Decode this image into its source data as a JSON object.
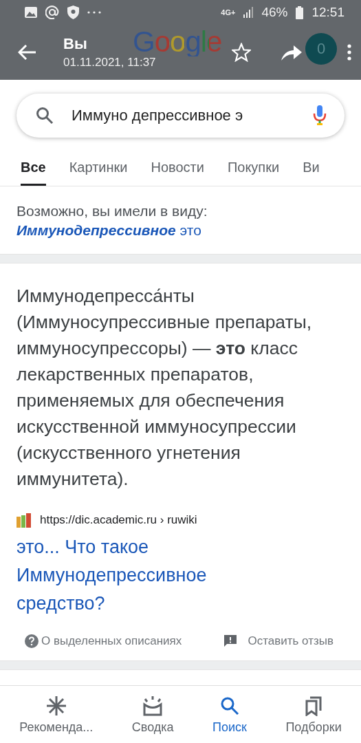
{
  "status_bar": {
    "network": "4G+",
    "battery": "46%",
    "time": "12:51"
  },
  "header": {
    "title": "Вы",
    "subtitle": "01.11.2021, 11:37",
    "logo": "Google",
    "avatar": "0",
    "starred": false
  },
  "search": {
    "value": "Иммуно депрессивное э"
  },
  "tabs": [
    {
      "label": "Все",
      "selected": true
    },
    {
      "label": "Картинки",
      "selected": false
    },
    {
      "label": "Новости",
      "selected": false
    },
    {
      "label": "Покупки",
      "selected": false
    },
    {
      "label": "Ви",
      "selected": false
    }
  ],
  "suggestion": {
    "prompt": "Возможно, вы имели в виду:",
    "link": "**Иммунодепрессивное** это"
  },
  "snippet": {
    "text": "Иммунодепресса́нты (Иммуносупрессивные препараты, иммуносупрессоры) — **это** класс лекарственных препаратов, применяемых для обеспечения искусственной иммуносупрессии (искусственного угнетения иммунитета).",
    "source": "https://dic.academic.ru › ruwiki",
    "title": "это... Что такое Иммунодепрессивное средство?",
    "about": "О выделенных описаниях",
    "feedback": "Оставить отзыв"
  },
  "bottom_nav": [
    {
      "label": "Рекоменда...",
      "kind": "discover",
      "selected": false
    },
    {
      "label": "Сводка",
      "kind": "updates",
      "selected": false
    },
    {
      "label": "Поиск",
      "kind": "search",
      "selected": true
    },
    {
      "label": "Подборки",
      "kind": "collections",
      "selected": false
    }
  ]
}
